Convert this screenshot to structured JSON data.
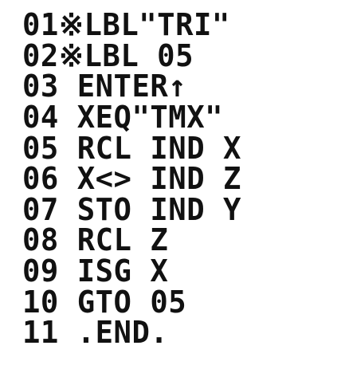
{
  "program": {
    "lines": [
      {
        "num": "01",
        "code": "※LBL\"TRI\""
      },
      {
        "num": "02",
        "code": "※LBL 05"
      },
      {
        "num": "03",
        "code": " ENTER↑"
      },
      {
        "num": "04",
        "code": " XEQ\"TMX\""
      },
      {
        "num": "05",
        "code": " RCL IND X"
      },
      {
        "num": "06",
        "code": " X<> IND Z"
      },
      {
        "num": "07",
        "code": " STO IND Y"
      },
      {
        "num": "08",
        "code": " RCL Z"
      },
      {
        "num": "09",
        "code": " ISG X"
      },
      {
        "num": "10",
        "code": " GTO 05"
      },
      {
        "num": "11",
        "code": " .END."
      }
    ]
  }
}
